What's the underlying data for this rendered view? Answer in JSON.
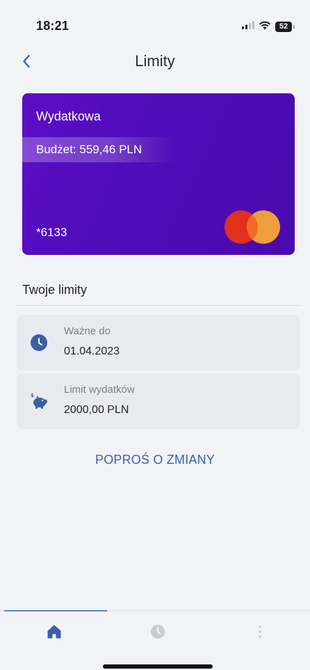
{
  "status_bar": {
    "time": "18:21",
    "battery_level": "52"
  },
  "header": {
    "title": "Limity"
  },
  "card": {
    "name": "Wydatkowa",
    "budget": "Budżet: 559,46 PLN",
    "number": "*6133",
    "colors": {
      "background": "#5b0ec6",
      "mc_red": "#e0301e",
      "mc_orange": "#f7a637"
    }
  },
  "limits": {
    "section_title": "Twoje limity",
    "items": [
      {
        "label": "Ważne do",
        "value": "01.04.2023",
        "icon": "clock-icon"
      },
      {
        "label": "Limit wydatków",
        "value": "2000,00 PLN",
        "icon": "piggy-bank-icon"
      }
    ]
  },
  "action": {
    "label": "POPROŚ O ZMIANY"
  },
  "tab_bar": {
    "tabs": [
      {
        "icon": "home-icon",
        "active": true
      },
      {
        "icon": "history-icon",
        "active": false
      },
      {
        "icon": "more-icon",
        "active": false
      }
    ]
  },
  "colors": {
    "accent": "#3a5fb8",
    "icon_blue": "#3c5fa8",
    "background": "#f2f3f7"
  }
}
